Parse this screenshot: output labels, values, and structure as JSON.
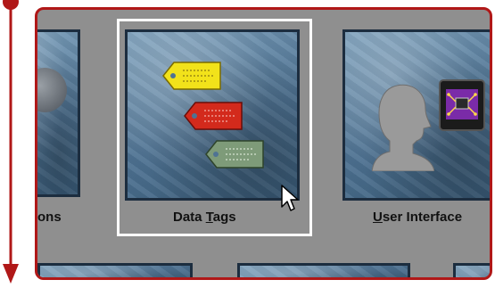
{
  "scroll_indicator": {
    "icon": "down-arrow-icon",
    "color": "#b01818"
  },
  "panel": {
    "border_color": "#b01818",
    "background": "#8f8f8f"
  },
  "tiles": [
    {
      "id": "left-partial",
      "label": "ons"
    },
    {
      "id": "data-tags",
      "label_prefix": "Data ",
      "label_accel": "T",
      "label_suffix": "ags",
      "selected": true
    },
    {
      "id": "user-interface",
      "label_accel": "U",
      "label_suffix": "ser Interface"
    }
  ],
  "icons": {
    "tags": [
      "yellow-tag-icon",
      "red-tag-icon",
      "green-tag-icon"
    ],
    "user_interface": [
      "head-silhouette-icon",
      "circuit-chip-icon"
    ],
    "pointer": "mouse-pointer-icon"
  }
}
